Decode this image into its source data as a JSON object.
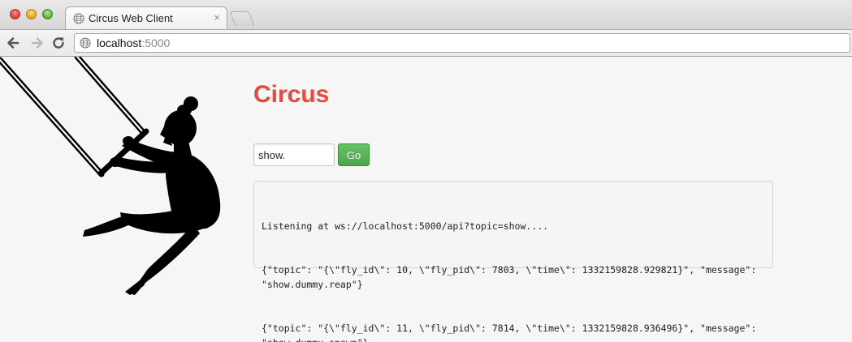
{
  "browser": {
    "tab": {
      "title": "Circus Web Client",
      "close_glyph": "×"
    },
    "omnibox": {
      "host": "localhost",
      "port": ":5000"
    },
    "icons": {
      "back": "back-arrow-icon",
      "forward": "forward-arrow-icon",
      "reload": "reload-icon",
      "favicon": "globe-icon",
      "new_tab": "new-tab-icon"
    }
  },
  "page": {
    "heading": "Circus",
    "heading_color": "#e8493a",
    "topic_input": {
      "value": "show."
    },
    "go_button": {
      "label": "Go",
      "color": "#4aa84a"
    },
    "log": {
      "lines": [
        "Listening at ws://localhost:5000/api?topic=show....",
        "{\"topic\": \"{\\\"fly_id\\\": 10, \\\"fly_pid\\\": 7803, \\\"time\\\": 1332159828.929821}\", \"message\": \"show.dummy.reap\"}",
        "{\"topic\": \"{\\\"fly_id\\\": 11, \\\"fly_pid\\\": 7814, \\\"time\\\": 1332159828.936496}\", \"message\": \"show.dummy.spawn\"}"
      ]
    },
    "illustration": "trapeze-acrobat-silhouette"
  }
}
